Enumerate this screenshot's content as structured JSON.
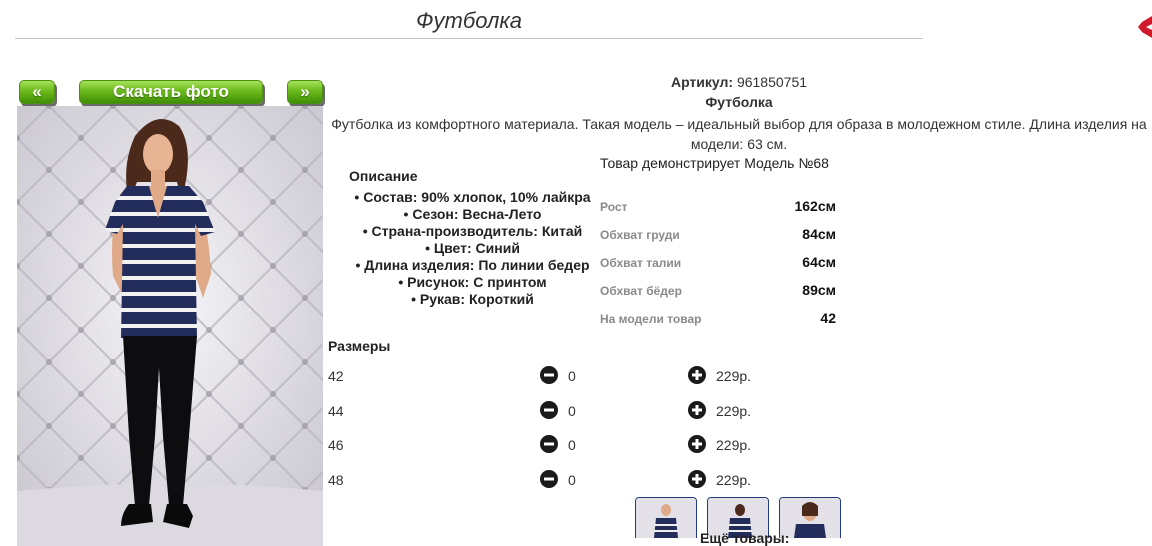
{
  "page": {
    "title": "Футболка"
  },
  "nav": {
    "prev_label": "«",
    "download_label": "Скачать фото",
    "next_label": "»"
  },
  "product": {
    "sku_label": "Артикул:",
    "sku_value": "961850751",
    "name": "Футболка",
    "description": "Футболка из комфортного материала. Такая модель – идеальный выбор для образа в молодежном стиле. Длина изделия на модели: 63 см.",
    "model_note": "Товар демонстрирует Модель №68"
  },
  "specs": {
    "heading": "Описание",
    "items": [
      "Состав: 90% хлопок, 10% лайкра",
      "Сезон: Весна-Лето",
      "Страна-производитель: Китай",
      "Цвет: Синий",
      "Длина изделия: По линии бедер",
      "Рисунок: С принтом",
      "Рукав: Короткий"
    ]
  },
  "measurements": [
    {
      "label": "Рост",
      "value": "162см"
    },
    {
      "label": "Обхват груди",
      "value": "84см"
    },
    {
      "label": "Обхват талии",
      "value": "64см"
    },
    {
      "label": "Обхват бёдер",
      "value": "89см"
    },
    {
      "label": "На модели товар",
      "value": "42"
    }
  ],
  "sizes": {
    "heading": "Размеры",
    "rows": [
      {
        "size": "42",
        "qty": "0",
        "price": "229р."
      },
      {
        "size": "44",
        "qty": "0",
        "price": "229р."
      },
      {
        "size": "46",
        "qty": "0",
        "price": "229р."
      },
      {
        "size": "48",
        "qty": "0",
        "price": "229р."
      }
    ]
  },
  "more_label": "Ещё товары:",
  "icons": {
    "close": "close-x-icon",
    "minus": "minus-circle-icon",
    "plus": "plus-circle-icon"
  },
  "colors": {
    "button_green": "#6cba1c",
    "close_red": "#d0192a",
    "shirt_navy": "#232d5c"
  }
}
